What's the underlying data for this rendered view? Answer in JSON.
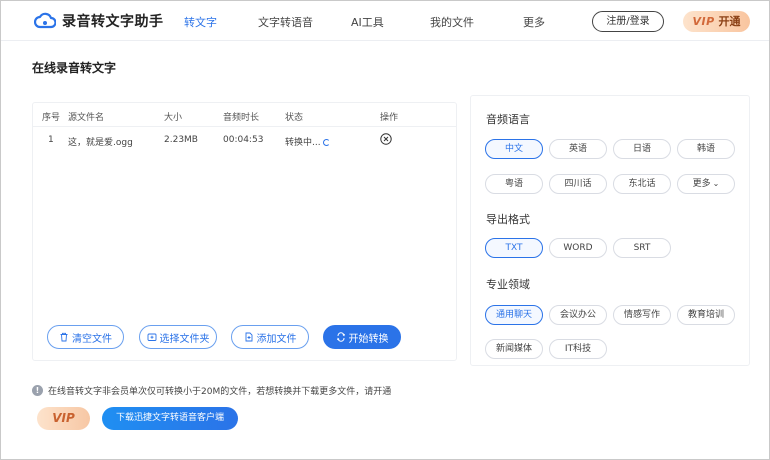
{
  "app": {
    "name": "录音转文字助手",
    "brand_color": "#2b73e8"
  },
  "nav": {
    "items": [
      {
        "label": "转文字",
        "active": true
      },
      {
        "label": "文字转语音",
        "active": false
      },
      {
        "label": "AI工具",
        "active": false
      },
      {
        "label": "我的文件",
        "active": false
      },
      {
        "label": "更多",
        "active": false
      }
    ],
    "register_label": "注册/登录",
    "vip_prefix": "VIP",
    "vip_label": "开通"
  },
  "page": {
    "title": "在线录音转文字"
  },
  "file_table": {
    "headers": [
      "序号",
      "源文件名",
      "大小",
      "音频时长",
      "状态",
      "操作"
    ],
    "rows": [
      {
        "index": "1",
        "name": "这，就是爱.ogg",
        "size": "2.23MB",
        "duration": "00:04:53",
        "status": "转换中...",
        "action_icon": "close-circle-icon"
      }
    ]
  },
  "actions": {
    "clear": "清空文件",
    "choose_folder": "选择文件夹",
    "add_file": "添加文件",
    "start": "开始转换"
  },
  "settings": {
    "language": {
      "title": "音频语言",
      "options": [
        "中文",
        "英语",
        "日语",
        "韩语",
        "粤语",
        "四川话",
        "东北话",
        "更多"
      ],
      "selected": "中文"
    },
    "export": {
      "title": "导出格式",
      "options": [
        "TXT",
        "WORD",
        "SRT"
      ],
      "selected": "TXT"
    },
    "domain": {
      "title": "专业领域",
      "options": [
        "通用聊天",
        "会议办公",
        "情感写作",
        "教育培训",
        "新闻媒体",
        "IT科技"
      ],
      "selected": "通用聊天"
    }
  },
  "footer": {
    "notice": "在线音转文字非会员单次仅可转换小于20M的文件，若想转换并下载更多文件，请开通",
    "vip_badge": "VIP",
    "download_label": "下载迅捷文字转语音客户端"
  }
}
